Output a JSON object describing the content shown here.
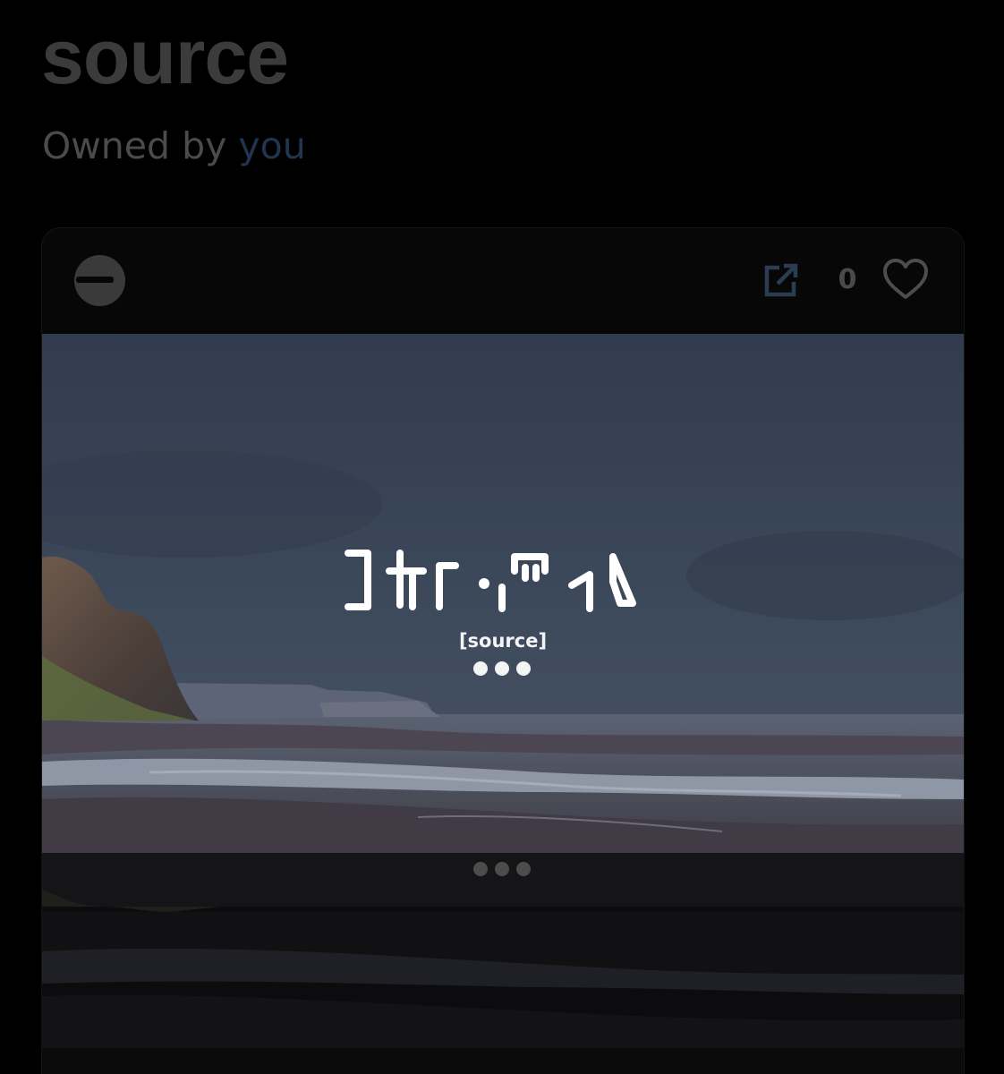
{
  "page": {
    "title": "source",
    "owner_prefix": "Owned by ",
    "owner_link": "you"
  },
  "card": {
    "avatar_icon": "minus-circle-icon",
    "open_icon": "external-link-icon",
    "like_icon": "heart-icon",
    "like_count": "0",
    "artwork": {
      "subtitle": "[source]",
      "loading_icon": "ellipsis-dots-icon"
    },
    "pager_dots": 3
  },
  "colors": {
    "background": "#000000",
    "title": "#3b3b3b",
    "owner_text": "#4b4b4b",
    "owner_link": "#1f3550",
    "card_bg": "#070707",
    "icon": "#2a3d52",
    "sky": "#384454"
  }
}
